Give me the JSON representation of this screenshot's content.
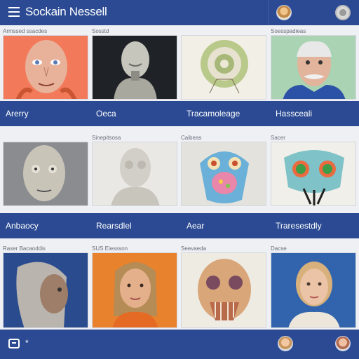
{
  "header": {
    "title": "Sockain Nessell",
    "menu_icon": "hamburger-menu-icon",
    "account_icon": "profile-icon"
  },
  "sections": [
    {
      "cards": [
        {
          "top_text": "Armssed ssacdes",
          "label": "Arerry"
        },
        {
          "top_text": "Sosstd",
          "label": "Oeca"
        },
        {
          "top_text": "",
          "label": "Tracamoleage"
        },
        {
          "top_text": "Soesspadieas",
          "label": "Hassceali"
        }
      ]
    },
    {
      "cards": [
        {
          "top_text": "",
          "label": "Anbaocy"
        },
        {
          "top_text": "Sinepitsosa",
          "label": "Rearsdlel"
        },
        {
          "top_text": "Caibeas",
          "label": "Aear"
        },
        {
          "top_text": "Sacer",
          "label": "Traresestdly"
        }
      ]
    },
    {
      "cards": [
        {
          "top_text": "Raser Bacaoddis",
          "label": ""
        },
        {
          "top_text": "SUS Eiessson",
          "label": ""
        },
        {
          "top_text": "Seevaeda",
          "label": ""
        },
        {
          "top_text": "Dacse",
          "label": ""
        }
      ]
    }
  ],
  "footer": {
    "mark": "*",
    "left_icon": "chat-icon"
  },
  "colors": {
    "brand": "#2b4a93",
    "background": "#eef0f4"
  }
}
